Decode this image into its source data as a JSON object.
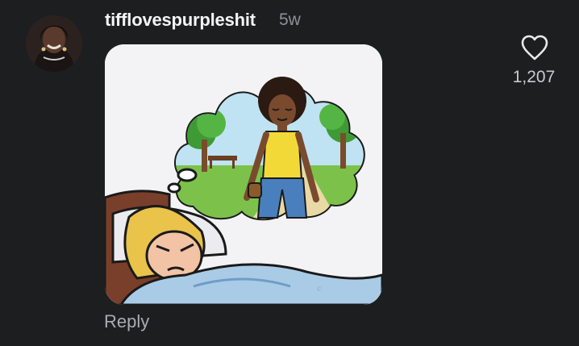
{
  "comment": {
    "username": "tifflovespurpleshit",
    "timestamp": "5w",
    "avatar_icon": "user-avatar",
    "like_icon": "heart-outline-icon",
    "like_count": "1,207",
    "reply_label": "Reply"
  },
  "colors": {
    "background": "#1c1e20",
    "username": "#f5f5f5",
    "muted": "#8e9196"
  }
}
